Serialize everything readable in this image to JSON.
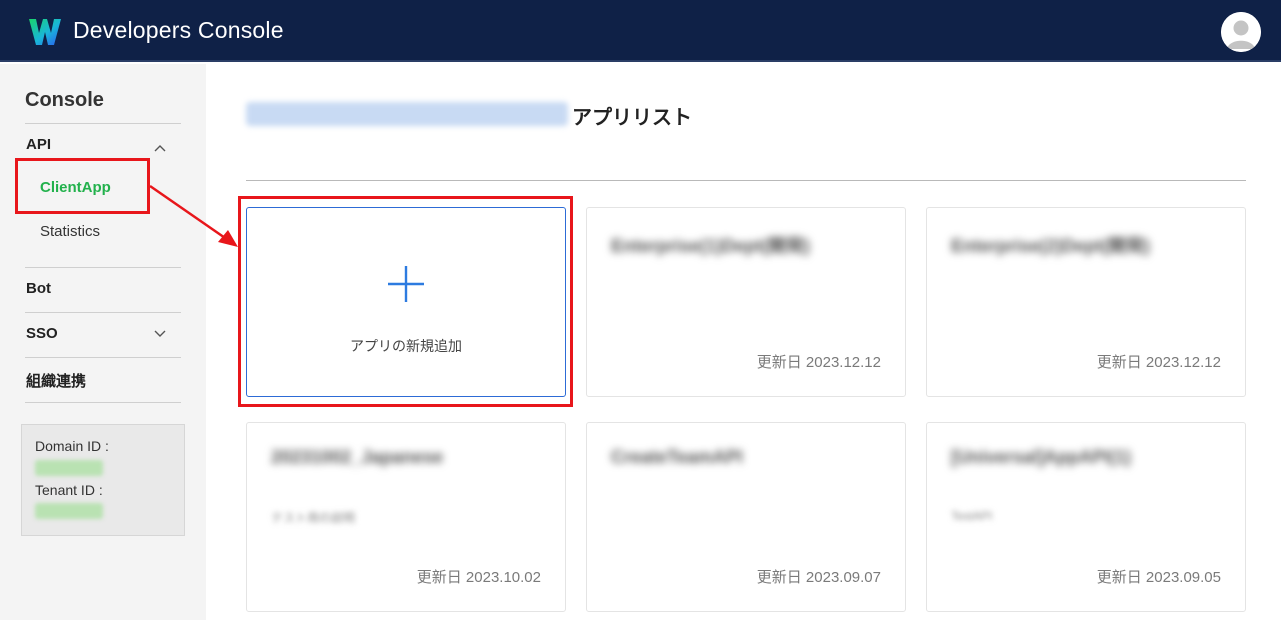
{
  "header": {
    "title": "Developers Console",
    "logo_icon": "works-logo-icon",
    "avatar_icon": "user-avatar-icon",
    "bg_color": "#0f2147"
  },
  "sidebar": {
    "heading": "Console",
    "sections": [
      {
        "label": "API",
        "expanded": true,
        "chevron_icon": "chevron-up-icon",
        "items": [
          {
            "label": "ClientApp",
            "active": true
          },
          {
            "label": "Statistics",
            "active": false
          }
        ]
      },
      {
        "label": "Bot"
      },
      {
        "label": "SSO",
        "expanded": false,
        "chevron_icon": "chevron-down-icon"
      },
      {
        "label": "組織連携"
      }
    ],
    "domain_label": "Domain ID :",
    "tenant_label": "Tenant ID :",
    "active_color": "#22b14c"
  },
  "main": {
    "title": "アプリリスト",
    "add_card": {
      "label": "アプリの新規追加",
      "icon": "plus-icon",
      "accent_color": "#2d6bd6"
    },
    "cards": [
      {
        "name": "Enterprise(1)Dept(開発)",
        "desc": "",
        "updated": "更新日 2023.12.12"
      },
      {
        "name": "Enterprise(2)Dept(開発)",
        "desc": "",
        "updated": "更新日 2023.12.12"
      },
      {
        "name": "20231002_Japanese",
        "desc": "テスト用の説明",
        "updated": "更新日 2023.10.02"
      },
      {
        "name": "CreateTeamAPI",
        "desc": "",
        "updated": "更新日 2023.09.07"
      },
      {
        "name": "[Universal]AppAPI(1)",
        "desc": "TestAPI",
        "updated": "更新日 2023.09.05"
      }
    ]
  },
  "annotation_color": "#e8161b"
}
